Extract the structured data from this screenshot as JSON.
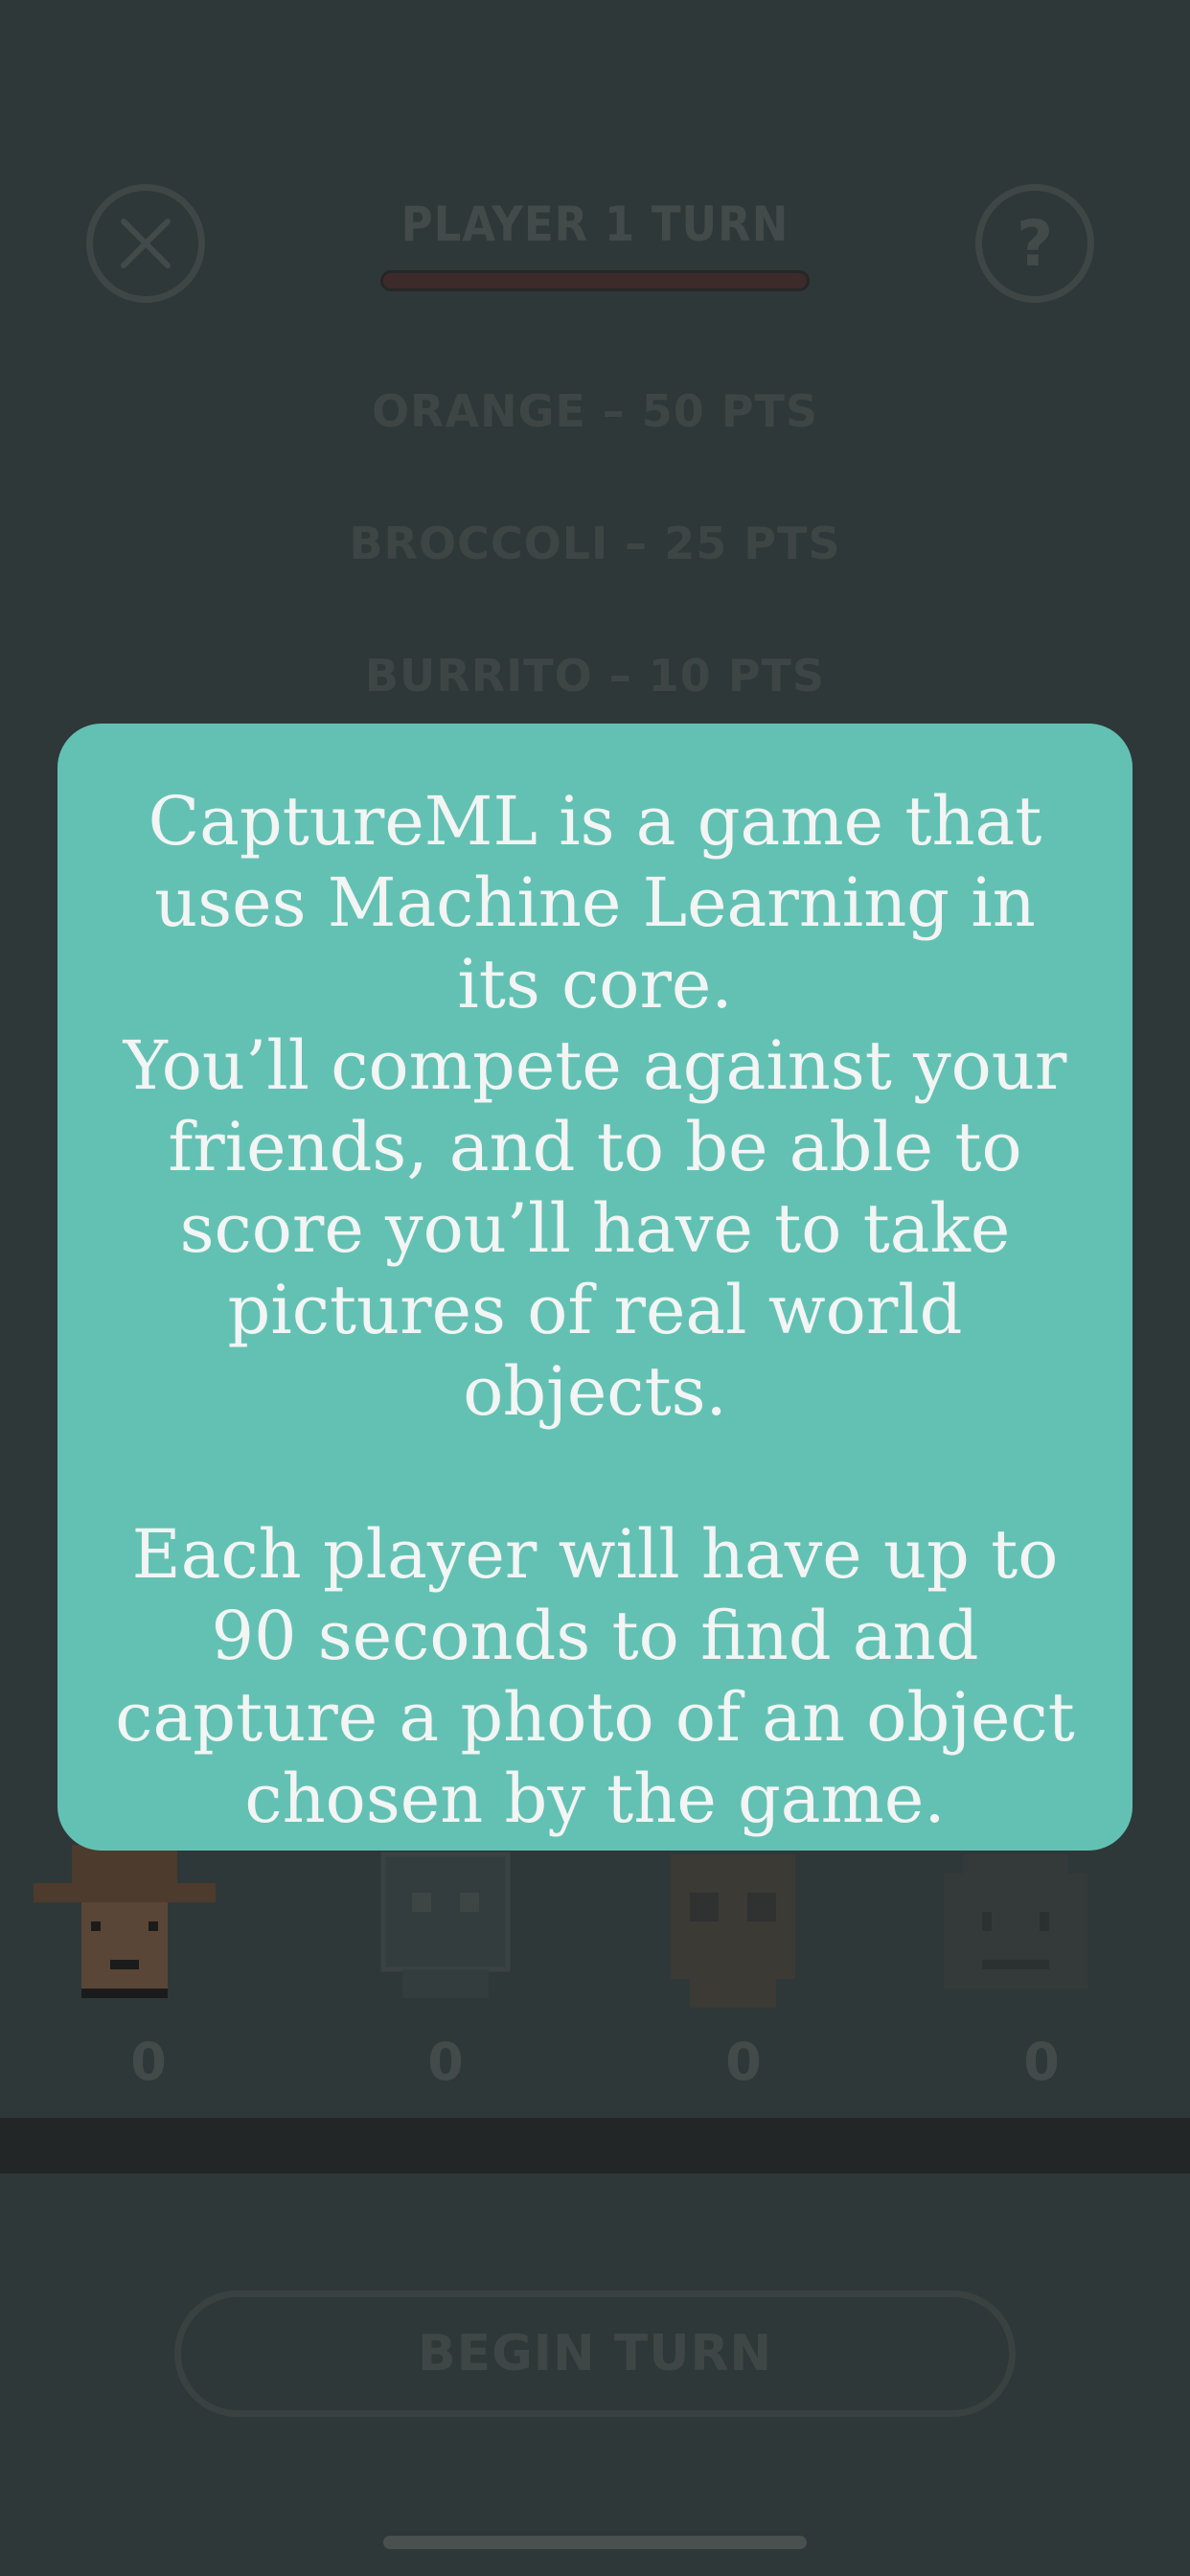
{
  "header": {
    "turn_title": "PLAYER 1 TURN",
    "close_label": "✕",
    "help_label": "?"
  },
  "objects": [
    {
      "label": "ORANGE – 50 PTS"
    },
    {
      "label": "BROCCOLI – 25 PTS"
    },
    {
      "label": "BURRITO – 10 PTS"
    }
  ],
  "players": [
    {
      "score": "0"
    },
    {
      "score": "0"
    },
    {
      "score": "0"
    },
    {
      "score": "0"
    }
  ],
  "footer": {
    "begin_label": "BEGIN TURN"
  },
  "modal": {
    "paragraph_1": "CaptureML is a game that uses Machine Learning in its core.",
    "paragraph_2": "You’ll compete against your friends, and to be able to score you’ll have to take pictures of real world objects.",
    "paragraph_3": "Each player will have up to 90 seconds to find and capture a photo of an object chosen by the game."
  },
  "colors": {
    "background": "#2e3838",
    "modal": "#63c1b4",
    "modal_text": "#f2f5f3"
  }
}
